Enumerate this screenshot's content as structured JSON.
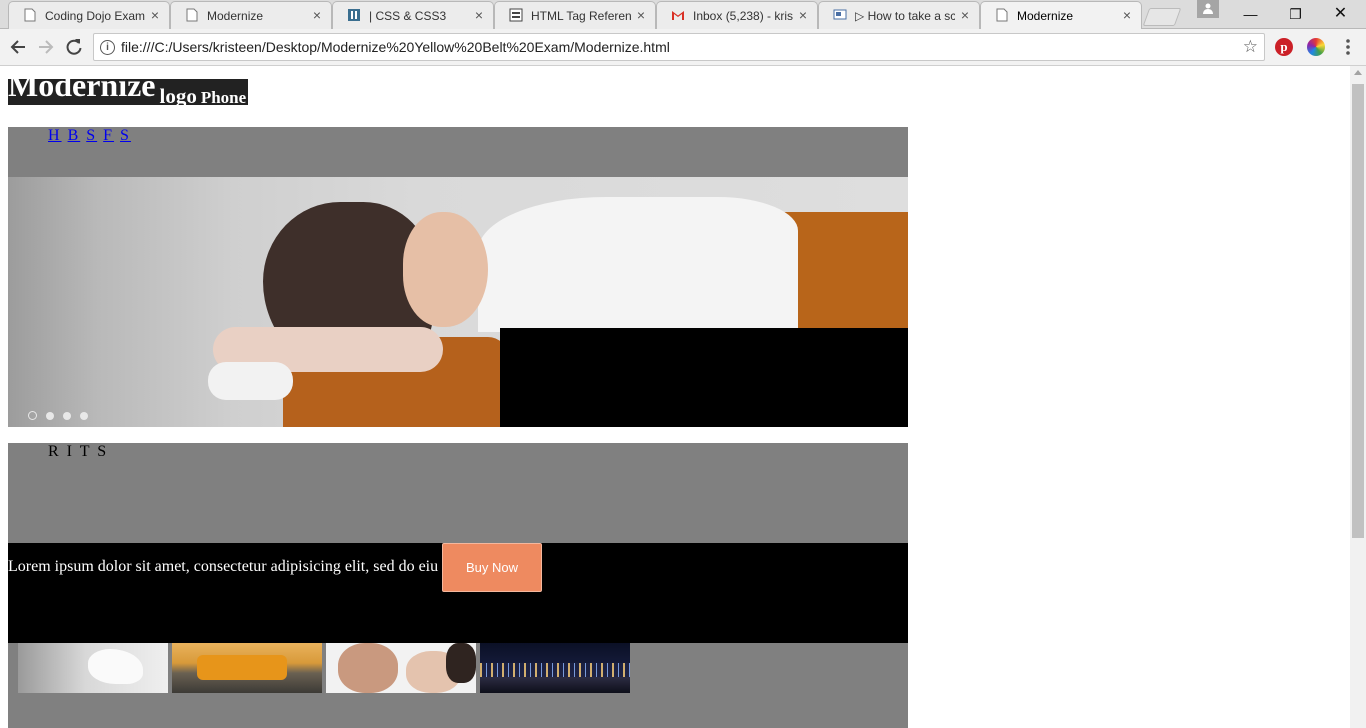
{
  "browser": {
    "tabs": [
      {
        "title": "Coding Dojo Exam",
        "icon": "page-icon"
      },
      {
        "title": "Modernize",
        "icon": "page-icon"
      },
      {
        "title": "| CSS & CSS3",
        "icon": "site-icon"
      },
      {
        "title": "HTML Tag Referen",
        "icon": "html-icon"
      },
      {
        "title": "Inbox (5,238) - kris",
        "icon": "gmail-icon"
      },
      {
        "title": "▷ How to take a sc",
        "icon": "site-icon"
      },
      {
        "title": "Modernize",
        "icon": "page-icon",
        "active": true
      }
    ],
    "close_glyph": "×",
    "window_controls": {
      "minimize": "—",
      "restore": "❐",
      "close": "✕"
    },
    "address": "file:///C:/Users/kristeen/Desktop/Modernize%20Yellow%20Belt%20Exam/Modernize.html",
    "colors": {
      "pinterest": "#cb2027",
      "tab_strip": "#dcdcdc"
    }
  },
  "page": {
    "header": {
      "brand": "Modernize",
      "logo": "logo",
      "phone": "Phone"
    },
    "nav_links": [
      "H",
      "B",
      "S",
      "F",
      "S"
    ],
    "section_letters": "R I T S",
    "cta": {
      "text": "Lorem ipsum dolor sit amet, consectetur adipisicing elit, sed do eiu",
      "button": "Buy Now",
      "button_color": "#ee8a60"
    },
    "slider_dots": 4
  }
}
